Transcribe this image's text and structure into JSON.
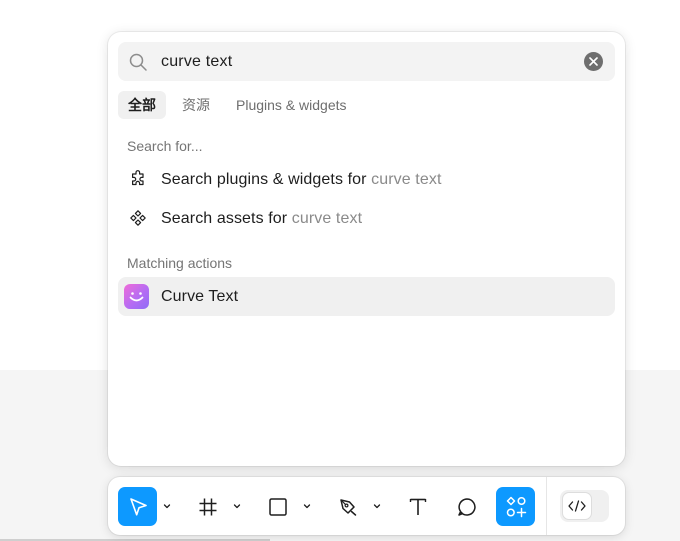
{
  "search": {
    "value": "curve text",
    "clear_icon": "close-circle-icon",
    "search_icon": "search-icon"
  },
  "tabs": [
    {
      "label": "全部",
      "active": true
    },
    {
      "label": "资源",
      "active": false
    },
    {
      "label": "Plugins & widgets",
      "active": false
    }
  ],
  "sections": {
    "search_for": "Search for...",
    "matching_actions": "Matching actions"
  },
  "search_for_items": [
    {
      "icon": "plugin-puzzle-icon",
      "prefix": "Search plugins & widgets for",
      "query": "curve text"
    },
    {
      "icon": "assets-component-icon",
      "prefix": "Search assets for",
      "query": "curve text"
    }
  ],
  "matching_actions": [
    {
      "icon": "curve-text-plugin-icon",
      "label": "Curve Text"
    }
  ],
  "toolbar": {
    "tools": [
      {
        "name": "move-tool",
        "icon": "cursor-arrow-icon",
        "active": true
      },
      {
        "name": "frame-tool",
        "icon": "frame-hash-icon",
        "active": false
      },
      {
        "name": "shape-tool",
        "icon": "rectangle-icon",
        "active": false
      },
      {
        "name": "pen-tool",
        "icon": "pen-nib-icon",
        "active": false
      },
      {
        "name": "text-tool",
        "icon": "text-t-icon",
        "active": false
      },
      {
        "name": "comment-tool",
        "icon": "comment-bubble-icon",
        "active": false
      },
      {
        "name": "actions-tool",
        "icon": "actions-grid-icon",
        "active": true
      }
    ],
    "dev_mode_icon": "code-brackets-icon"
  },
  "colors": {
    "accent": "#0d99ff",
    "highlight_row": "#f0f0f0",
    "canvas": "#f5f5f5"
  }
}
